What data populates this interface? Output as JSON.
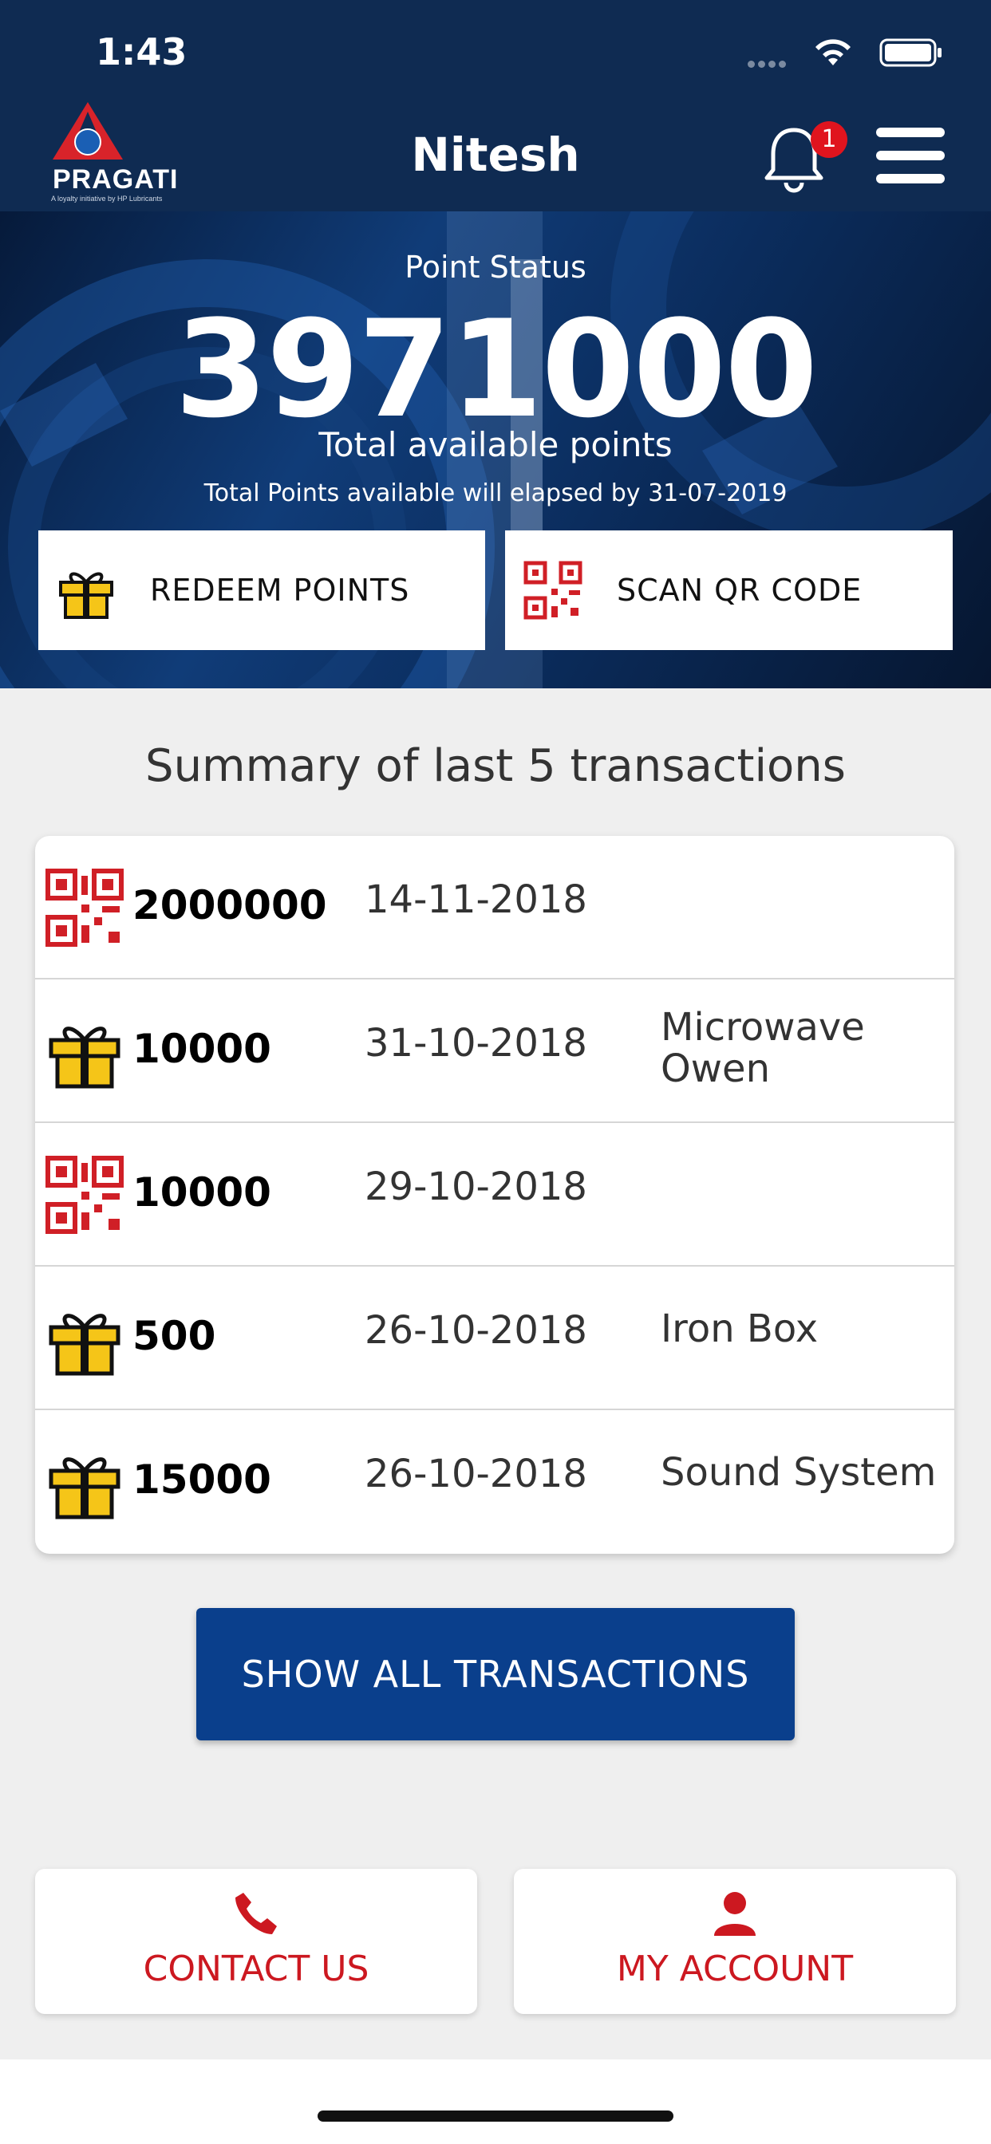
{
  "status_bar": {
    "time": "1:43"
  },
  "header": {
    "brand": "PRAGATI",
    "brand_tagline": "A loyalty initiative by HP Lubricants",
    "title": "Nitesh",
    "notification_count": "1"
  },
  "hero": {
    "label": "Point Status",
    "points": "3971000",
    "subtitle": "Total available points",
    "expiry_note": "Total Points available will elapsed by 31-07-2019",
    "redeem_label": "REDEEM POINTS",
    "scan_label": "SCAN QR CODE"
  },
  "summary": {
    "title": "Summary of last 5 transactions",
    "transactions": [
      {
        "icon": "qr-code-icon",
        "points": "2000000",
        "date": "14-11-2018",
        "item": ""
      },
      {
        "icon": "gift-icon",
        "points": "10000",
        "date": "31-10-2018",
        "item": "Microwave Owen"
      },
      {
        "icon": "qr-code-icon",
        "points": "10000",
        "date": "29-10-2018",
        "item": ""
      },
      {
        "icon": "gift-icon",
        "points": "500",
        "date": "26-10-2018",
        "item": "Iron Box"
      },
      {
        "icon": "gift-icon",
        "points": "15000",
        "date": "26-10-2018",
        "item": "Sound System"
      }
    ],
    "show_all_label": "SHOW ALL TRANSACTIONS"
  },
  "footer": {
    "contact_label": "CONTACT US",
    "account_label": "MY ACCOUNT"
  },
  "colors": {
    "header_bg": "#0f2b52",
    "primary_button": "#0a3f8c",
    "accent_red": "#cc1820",
    "gift_yellow": "#f5c518",
    "badge_red": "#e0141e"
  }
}
